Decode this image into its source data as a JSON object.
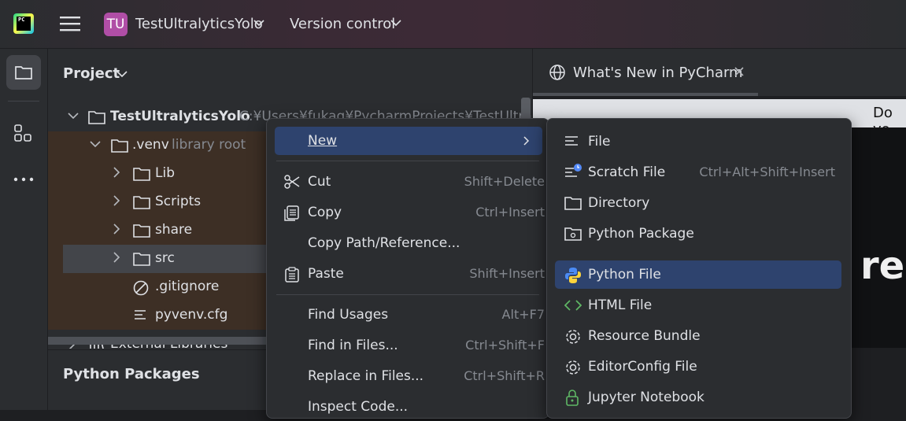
{
  "titlebar": {
    "logo_text": "PC",
    "project_badge": "TU",
    "project_name": "TestUltralyticsYolo",
    "version_control": "Version control"
  },
  "toolbar": {
    "items": [
      "folder-icon",
      "structure-icon",
      "more-icon"
    ]
  },
  "project_panel": {
    "title": "Project",
    "tree": [
      {
        "label": "TestUltralyticsYolo",
        "suffix": "C:¥Users¥fukag¥PycharmProjects¥TestUltralytics",
        "icon": "folder-icon",
        "expanded": true
      },
      {
        "label": ".venv",
        "suffix": "library root",
        "icon": "folder-icon",
        "expanded": true
      },
      {
        "label": "Lib",
        "icon": "folder-icon"
      },
      {
        "label": "Scripts",
        "icon": "folder-icon"
      },
      {
        "label": "share",
        "icon": "folder-icon"
      },
      {
        "label": "src",
        "icon": "folder-icon"
      },
      {
        "label": ".gitignore",
        "icon": "ignore-file-icon"
      },
      {
        "label": "pyvenv.cfg",
        "icon": "text-file-icon"
      },
      {
        "label": "External Libraries",
        "icon": "library-icon"
      }
    ]
  },
  "packages_panel": {
    "title": "Python Packages"
  },
  "editor": {
    "tab_label": "What's New in PyCharm",
    "banner_text": "Do yo",
    "big_text": "res"
  },
  "context_menu": {
    "items": [
      {
        "label": "New",
        "shortcut": "",
        "submenu": true
      },
      {
        "label": "Cut",
        "shortcut": "Shift+Delete",
        "icon": "scissors-icon"
      },
      {
        "label": "Copy",
        "shortcut": "Ctrl+Insert",
        "icon": "copy-icon"
      },
      {
        "label": "Copy Path/Reference...",
        "shortcut": ""
      },
      {
        "label": "Paste",
        "shortcut": "Shift+Insert",
        "icon": "paste-icon"
      },
      {
        "label": "Find Usages",
        "shortcut": "Alt+F7"
      },
      {
        "label": "Find in Files...",
        "shortcut": "Ctrl+Shift+F"
      },
      {
        "label": "Replace in Files...",
        "shortcut": "Ctrl+Shift+R"
      },
      {
        "label": "Inspect Code...",
        "shortcut": ""
      }
    ]
  },
  "submenu": {
    "items": [
      {
        "label": "File",
        "shortcut": "",
        "icon": "text-file-icon"
      },
      {
        "label": "Scratch File",
        "shortcut": "Ctrl+Alt+Shift+Insert",
        "icon": "scratch-file-icon"
      },
      {
        "label": "Directory",
        "shortcut": "",
        "icon": "folder-icon"
      },
      {
        "label": "Python Package",
        "shortcut": "",
        "icon": "package-icon"
      },
      {
        "label": "Python File",
        "shortcut": "",
        "icon": "python-icon"
      },
      {
        "label": "HTML File",
        "shortcut": "",
        "icon": "html-icon"
      },
      {
        "label": "Resource Bundle",
        "shortcut": "",
        "icon": "gear-icon"
      },
      {
        "label": "EditorConfig File",
        "shortcut": "",
        "icon": "gear-icon"
      },
      {
        "label": "Jupyter Notebook",
        "shortcut": "",
        "icon": "jupyter-icon"
      }
    ]
  },
  "colors": {
    "accent": "#2e436e",
    "project_badge": "#b04ea6",
    "highlight_row": "#3d2f25"
  }
}
